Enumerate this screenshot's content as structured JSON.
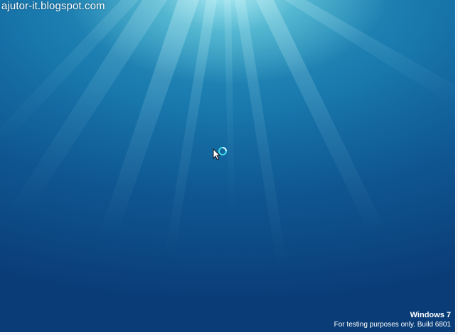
{
  "watermark": "ajutor-it.blogspot.com",
  "branding": {
    "os_name": "Windows 7",
    "build_note": "For testing purposes only. Build 6801"
  },
  "cursor": {
    "icon": "busy-pointer-icon",
    "ring_color": "#3fd8e6"
  },
  "colors": {
    "background_top": "#9fe3ee",
    "background_bottom": "#0a3d78"
  }
}
